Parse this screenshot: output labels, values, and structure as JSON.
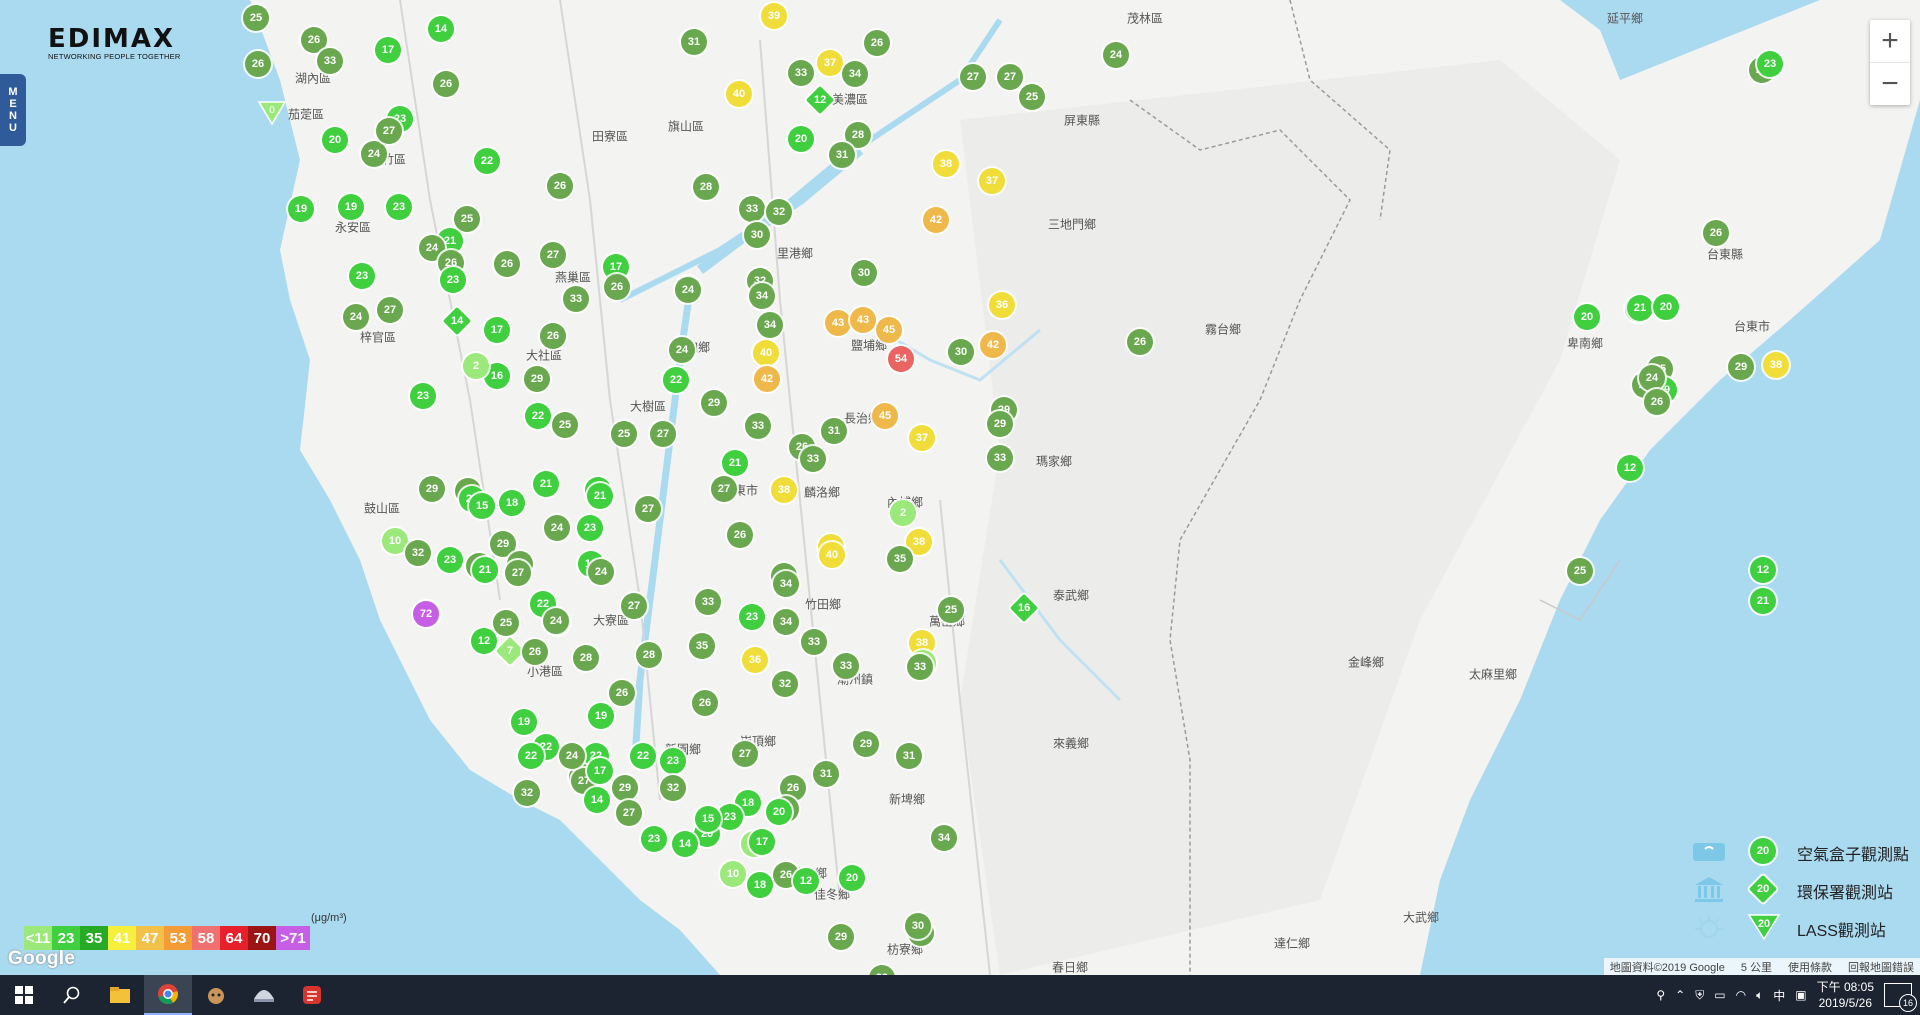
{
  "app": {
    "brand": "EDIMAX",
    "tagline": "NETWORKING PEOPLE TOGETHER",
    "menu_label": "MENU"
  },
  "zoom": {
    "in_label": "+",
    "out_label": "−"
  },
  "places": [
    {
      "name": "茂林區"
    },
    {
      "name": "延平鄉"
    },
    {
      "name": "湖內區"
    },
    {
      "name": "茄萣區"
    },
    {
      "name": "田寮區"
    },
    {
      "name": "旗山區"
    },
    {
      "name": "美濃區"
    },
    {
      "name": "永安區"
    },
    {
      "name": "路竹區"
    },
    {
      "name": "燕巢區"
    },
    {
      "name": "里港鄉"
    },
    {
      "name": "三地門鄉"
    },
    {
      "name": "梓官區"
    },
    {
      "name": "大社區"
    },
    {
      "name": "九如鄉"
    },
    {
      "name": "鹽埔鄉"
    },
    {
      "name": "霧台鄉"
    },
    {
      "name": "台東市"
    },
    {
      "name": "大樹區"
    },
    {
      "name": "長治鄉"
    },
    {
      "name": "卑南鄉"
    },
    {
      "name": "瑪家鄉"
    },
    {
      "name": "麟洛鄉"
    },
    {
      "name": "內埔鄉"
    },
    {
      "name": "鼓山區"
    },
    {
      "name": "竹田鄉"
    },
    {
      "name": "泰武鄉"
    },
    {
      "name": "大寮區"
    },
    {
      "name": "萬巒鄉"
    },
    {
      "name": "小港區"
    },
    {
      "name": "金峰鄉"
    },
    {
      "name": "太麻里鄉"
    },
    {
      "name": "新園鄉"
    },
    {
      "name": "崁頂鄉"
    },
    {
      "name": "來義鄉"
    },
    {
      "name": "林園區"
    },
    {
      "name": "新埤鄉"
    },
    {
      "name": "東港鎮"
    },
    {
      "name": "林邊鄉"
    },
    {
      "name": "佳冬鄉"
    },
    {
      "name": "枋寮鄉"
    },
    {
      "name": "大武鄉"
    },
    {
      "name": "達仁鄉"
    },
    {
      "name": "春日鄉"
    },
    {
      "name": "潮州鎮"
    },
    {
      "name": "屏東市"
    },
    {
      "name": "台東縣"
    },
    {
      "name": "屏東縣"
    }
  ],
  "stations": [
    {
      "v": "25",
      "t": "c"
    },
    {
      "v": "26",
      "t": "c"
    },
    {
      "v": "33",
      "t": "c"
    },
    {
      "v": "26",
      "t": "c"
    },
    {
      "v": "14",
      "t": "c"
    },
    {
      "v": "17",
      "t": "c"
    },
    {
      "v": "31",
      "t": "c"
    },
    {
      "v": "39",
      "t": "c"
    },
    {
      "v": "26",
      "t": "c"
    },
    {
      "v": "33",
      "t": "c"
    },
    {
      "v": "37",
      "t": "c"
    },
    {
      "v": "34",
      "t": "c"
    },
    {
      "v": "40",
      "t": "c"
    },
    {
      "v": "12",
      "t": "d"
    },
    {
      "v": "27",
      "t": "c"
    },
    {
      "v": "25",
      "t": "c"
    },
    {
      "v": "24",
      "t": "c"
    },
    {
      "v": "27",
      "t": "c"
    },
    {
      "v": "23",
      "t": "c"
    },
    {
      "v": "0",
      "t": "t"
    },
    {
      "v": "26",
      "t": "c"
    },
    {
      "v": "23",
      "t": "c"
    },
    {
      "v": "20",
      "t": "c"
    },
    {
      "v": "24",
      "t": "c"
    },
    {
      "v": "27",
      "t": "c"
    },
    {
      "v": "22",
      "t": "c"
    },
    {
      "v": "20",
      "t": "c"
    },
    {
      "v": "28",
      "t": "c"
    },
    {
      "v": "31",
      "t": "c"
    },
    {
      "v": "38",
      "t": "c"
    },
    {
      "v": "37",
      "t": "c"
    },
    {
      "v": "26",
      "t": "c"
    },
    {
      "v": "28",
      "t": "c"
    },
    {
      "v": "19",
      "t": "c"
    },
    {
      "v": "19",
      "t": "c"
    },
    {
      "v": "23",
      "t": "c"
    },
    {
      "v": "25",
      "t": "c"
    },
    {
      "v": "33",
      "t": "c"
    },
    {
      "v": "32",
      "t": "c"
    },
    {
      "v": "30",
      "t": "c"
    },
    {
      "v": "42",
      "t": "c"
    },
    {
      "v": "27",
      "t": "c"
    },
    {
      "v": "21",
      "t": "c"
    },
    {
      "v": "24",
      "t": "c"
    },
    {
      "v": "26",
      "t": "c"
    },
    {
      "v": "26",
      "t": "c"
    },
    {
      "v": "27",
      "t": "c"
    },
    {
      "v": "23",
      "t": "c"
    },
    {
      "v": "23",
      "t": "c"
    },
    {
      "v": "17",
      "t": "c"
    },
    {
      "v": "26",
      "t": "c"
    },
    {
      "v": "24",
      "t": "c"
    },
    {
      "v": "32",
      "t": "c"
    },
    {
      "v": "34",
      "t": "c"
    },
    {
      "v": "30",
      "t": "c"
    },
    {
      "v": "36",
      "t": "c"
    },
    {
      "v": "27",
      "t": "c"
    },
    {
      "v": "24",
      "t": "c"
    },
    {
      "v": "33",
      "t": "c"
    },
    {
      "v": "24",
      "t": "c"
    },
    {
      "v": "14",
      "t": "d"
    },
    {
      "v": "17",
      "t": "c"
    },
    {
      "v": "26",
      "t": "c"
    },
    {
      "v": "34",
      "t": "c"
    },
    {
      "v": "43",
      "t": "c"
    },
    {
      "v": "43",
      "t": "c"
    },
    {
      "v": "45",
      "t": "c"
    },
    {
      "v": "54",
      "t": "c"
    },
    {
      "v": "30",
      "t": "c"
    },
    {
      "v": "42",
      "t": "c"
    },
    {
      "v": "26",
      "t": "c"
    },
    {
      "v": "27",
      "t": "c"
    },
    {
      "v": "21",
      "t": "c"
    },
    {
      "v": "20",
      "t": "c"
    },
    {
      "v": "16",
      "t": "c"
    },
    {
      "v": "29",
      "t": "c"
    },
    {
      "v": "24",
      "t": "c"
    },
    {
      "v": "40",
      "t": "c"
    },
    {
      "v": "42",
      "t": "c"
    },
    {
      "v": "22",
      "t": "c"
    },
    {
      "v": "23",
      "t": "c"
    },
    {
      "v": "2",
      "t": "c"
    },
    {
      "v": "22",
      "t": "c"
    },
    {
      "v": "25",
      "t": "c"
    },
    {
      "v": "27",
      "t": "c"
    },
    {
      "v": "25",
      "t": "c"
    },
    {
      "v": "29",
      "t": "c"
    },
    {
      "v": "31",
      "t": "c"
    },
    {
      "v": "45",
      "t": "c"
    },
    {
      "v": "29",
      "t": "c"
    },
    {
      "v": "29",
      "t": "c"
    },
    {
      "v": "24",
      "t": "c"
    },
    {
      "v": "25",
      "t": "c"
    },
    {
      "v": "29",
      "t": "c"
    },
    {
      "v": "19",
      "t": "c"
    },
    {
      "v": "33",
      "t": "c"
    },
    {
      "v": "26",
      "t": "c"
    },
    {
      "v": "33",
      "t": "c"
    },
    {
      "v": "37",
      "t": "c"
    },
    {
      "v": "33",
      "t": "c"
    },
    {
      "v": "21",
      "t": "c"
    },
    {
      "v": "27",
      "t": "c"
    },
    {
      "v": "26",
      "t": "c"
    },
    {
      "v": "23",
      "t": "c"
    },
    {
      "v": "29",
      "t": "c"
    },
    {
      "v": "15",
      "t": "c"
    },
    {
      "v": "18",
      "t": "c"
    },
    {
      "v": "21",
      "t": "c"
    },
    {
      "v": "20",
      "t": "c"
    },
    {
      "v": "21",
      "t": "c"
    },
    {
      "v": "27",
      "t": "c"
    },
    {
      "v": "38",
      "t": "c"
    },
    {
      "v": "12",
      "t": "c"
    },
    {
      "v": "10",
      "t": "c"
    },
    {
      "v": "32",
      "t": "c"
    },
    {
      "v": "23",
      "t": "c"
    },
    {
      "v": "24",
      "t": "c"
    },
    {
      "v": "29",
      "t": "c"
    },
    {
      "v": "26",
      "t": "c"
    },
    {
      "v": "24",
      "t": "c"
    },
    {
      "v": "27",
      "t": "c"
    },
    {
      "v": "23",
      "t": "c"
    },
    {
      "v": "19",
      "t": "c"
    },
    {
      "v": "21",
      "t": "c"
    },
    {
      "v": "24",
      "t": "c"
    },
    {
      "v": "26",
      "t": "c"
    },
    {
      "v": "2",
      "t": "c"
    },
    {
      "v": "38",
      "t": "c"
    },
    {
      "v": "37",
      "t": "c"
    },
    {
      "v": "40",
      "t": "c"
    },
    {
      "v": "35",
      "t": "c"
    },
    {
      "v": "34",
      "t": "c"
    },
    {
      "v": "25",
      "t": "c"
    },
    {
      "v": "29",
      "t": "c"
    },
    {
      "v": "25",
      "t": "c"
    },
    {
      "v": "72",
      "t": "c"
    },
    {
      "v": "25",
      "t": "c"
    },
    {
      "v": "22",
      "t": "c"
    },
    {
      "v": "27",
      "t": "c"
    },
    {
      "v": "28",
      "t": "c"
    },
    {
      "v": "25",
      "t": "c"
    },
    {
      "v": "33",
      "t": "c"
    },
    {
      "v": "23",
      "t": "c"
    },
    {
      "v": "34",
      "t": "c"
    },
    {
      "v": "12",
      "t": "c"
    },
    {
      "v": "7",
      "t": "d"
    },
    {
      "v": "26",
      "t": "c"
    },
    {
      "v": "24",
      "t": "c"
    },
    {
      "v": "28",
      "t": "c"
    },
    {
      "v": "35",
      "t": "c"
    },
    {
      "v": "34",
      "t": "c"
    },
    {
      "v": "33",
      "t": "c"
    },
    {
      "v": "38",
      "t": "c"
    },
    {
      "v": "0",
      "t": "c"
    },
    {
      "v": "36",
      "t": "c"
    },
    {
      "v": "33",
      "t": "c"
    },
    {
      "v": "26",
      "t": "c"
    },
    {
      "v": "32",
      "t": "c"
    },
    {
      "v": "33",
      "t": "c"
    },
    {
      "v": "34",
      "t": "c"
    },
    {
      "v": "16",
      "t": "d"
    },
    {
      "v": "26",
      "t": "c"
    },
    {
      "v": "19",
      "t": "c"
    },
    {
      "v": "19",
      "t": "c"
    },
    {
      "v": "22",
      "t": "c"
    },
    {
      "v": "22",
      "t": "c"
    },
    {
      "v": "22",
      "t": "c"
    },
    {
      "v": "23",
      "t": "c"
    },
    {
      "v": "32",
      "t": "c"
    },
    {
      "v": "27",
      "t": "c"
    },
    {
      "v": "26",
      "t": "c"
    },
    {
      "v": "31",
      "t": "c"
    },
    {
      "v": "29",
      "t": "c"
    },
    {
      "v": "31",
      "t": "c"
    },
    {
      "v": "24",
      "t": "c"
    },
    {
      "v": "18",
      "t": "c"
    },
    {
      "v": "20",
      "t": "c"
    },
    {
      "v": "23",
      "t": "c"
    },
    {
      "v": "20",
      "t": "c"
    },
    {
      "v": "7",
      "t": "c"
    },
    {
      "v": "14",
      "t": "c"
    },
    {
      "v": "17",
      "t": "c"
    },
    {
      "v": "26",
      "t": "c"
    },
    {
      "v": "18",
      "t": "c"
    },
    {
      "v": "10",
      "t": "c"
    },
    {
      "v": "15",
      "t": "c"
    },
    {
      "v": "29",
      "t": "c"
    },
    {
      "v": "27",
      "t": "c"
    },
    {
      "v": "23",
      "t": "c"
    },
    {
      "v": "25",
      "t": "c"
    },
    {
      "v": "27",
      "t": "c"
    },
    {
      "v": "22",
      "t": "c"
    },
    {
      "v": "32",
      "t": "c"
    },
    {
      "v": "24",
      "t": "c"
    },
    {
      "v": "17",
      "t": "c"
    },
    {
      "v": "14",
      "t": "c"
    },
    {
      "v": "12",
      "t": "c"
    },
    {
      "v": "20",
      "t": "c"
    },
    {
      "v": "29",
      "t": "c"
    },
    {
      "v": "31",
      "t": "c"
    },
    {
      "v": "30",
      "t": "c"
    },
    {
      "v": "29",
      "t": "c"
    },
    {
      "v": "20",
      "t": "c"
    },
    {
      "v": "24",
      "t": "c"
    },
    {
      "v": "26",
      "t": "c"
    },
    {
      "v": "38",
      "t": "c"
    },
    {
      "v": "12",
      "t": "c"
    },
    {
      "v": "21",
      "t": "c"
    },
    {
      "v": "26",
      "t": "c"
    }
  ],
  "color_scale": [
    {
      "label": "<11",
      "color": "#9be87b"
    },
    {
      "label": "23",
      "color": "#3fcf3f"
    },
    {
      "label": "35",
      "color": "#27ab27"
    },
    {
      "label": "41",
      "color": "#f6f03c"
    },
    {
      "label": "47",
      "color": "#f2c14a"
    },
    {
      "label": "53",
      "color": "#f39b37"
    },
    {
      "label": "58",
      "color": "#f07070"
    },
    {
      "label": "64",
      "color": "#e8202b"
    },
    {
      "label": "70",
      "color": "#9b1515"
    },
    {
      "label": ">71",
      "color": "#c65ee6"
    }
  ],
  "unit": "(μg/m³)",
  "station_legend": [
    {
      "value": "20",
      "label": "空氣盒子觀測點"
    },
    {
      "value": "20",
      "label": "環保署觀測站"
    },
    {
      "value": "20",
      "label": "LASS觀測站"
    }
  ],
  "attribution": {
    "data": "地圖資料©2019 Google",
    "scale": "5 公里",
    "terms": "使用條款",
    "report": "回報地圖錯誤",
    "google": "Google"
  },
  "taskbar": {
    "time": "下午 08:05",
    "date": "2019/5/26",
    "ime": "中",
    "notifications": "16"
  }
}
